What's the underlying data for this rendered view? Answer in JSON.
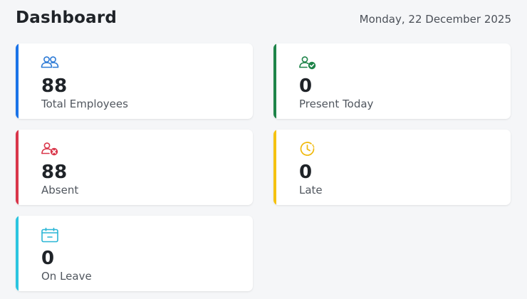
{
  "header": {
    "title": "Dashboard",
    "date": "Monday, 22 December 2025"
  },
  "cards": [
    {
      "value": "88",
      "label": "Total Employees",
      "accent": "#1a73e8",
      "icon": "users-icon"
    },
    {
      "value": "0",
      "label": "Present Today",
      "accent": "#1e8449",
      "icon": "user-check-icon"
    },
    {
      "value": "88",
      "label": "Absent",
      "accent": "#d9364a",
      "icon": "user-x-icon"
    },
    {
      "value": "0",
      "label": "Late",
      "accent": "#f5c211",
      "icon": "clock-icon"
    },
    {
      "value": "0",
      "label": "On Leave",
      "accent": "#2bc5e0",
      "icon": "calendar-icon"
    }
  ]
}
